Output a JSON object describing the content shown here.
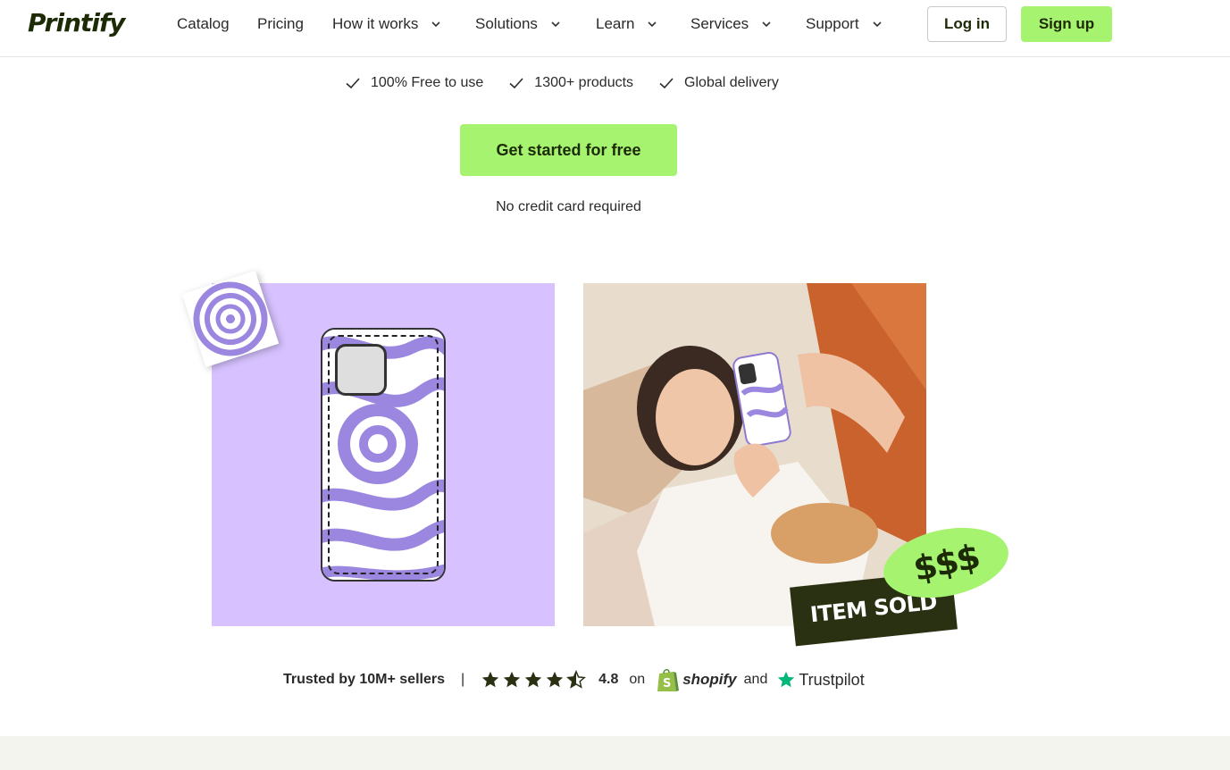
{
  "header": {
    "logo": "Printify",
    "nav": {
      "catalog": "Catalog",
      "pricing": "Pricing",
      "how_it_works": "How it works",
      "solutions": "Solutions",
      "learn": "Learn",
      "services": "Services",
      "support": "Support"
    },
    "login_label": "Log in",
    "signup_label": "Sign up"
  },
  "benefits": [
    "100% Free to use",
    "1300+ products",
    "Global delivery"
  ],
  "cta_label": "Get started for free",
  "cta_note": "No credit card required",
  "badges": {
    "money": "$$$",
    "sold": "ITEM SOLD"
  },
  "trust": {
    "text": "Trusted by 10M+ sellers",
    "separator": "|",
    "rating": "4.8",
    "rating_value": 4.8,
    "on": "on",
    "shopify": "shopify",
    "and": "and",
    "trustpilot": "Trustpilot"
  },
  "colors": {
    "accent": "#a6f36f",
    "dark": "#1c2a06",
    "lavender": "#d7c2ff",
    "swirl": "#9b86e0",
    "trustpilot_green": "#00b67a",
    "shopify_green": "#95bf47"
  }
}
